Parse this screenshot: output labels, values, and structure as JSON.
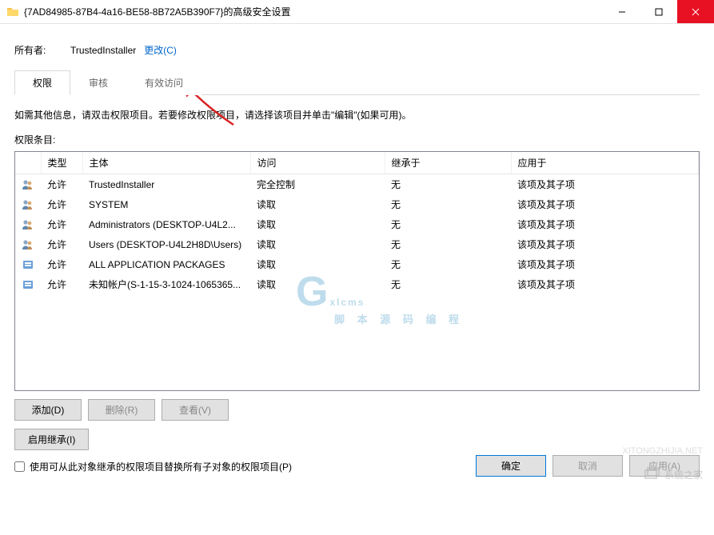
{
  "window": {
    "title": "{7AD84985-87B4-4a16-BE58-8B72A5B390F7}的高级安全设置"
  },
  "owner": {
    "label": "所有者:",
    "value": "TrustedInstaller",
    "change_link": "更改(C)"
  },
  "tabs": {
    "permissions": "权限",
    "audit": "审核",
    "effective": "有效访问"
  },
  "instructions": "如需其他信息，请双击权限项目。若要修改权限项目，请选择该项目并单击\"编辑\"(如果可用)。",
  "entries_label": "权限条目:",
  "columns": {
    "type": "类型",
    "principal": "主体",
    "access": "访问",
    "inherited_from": "继承于",
    "applies_to": "应用于"
  },
  "rows": [
    {
      "icon": "users",
      "type": "允许",
      "principal": "TrustedInstaller",
      "access": "完全控制",
      "inherited_from": "无",
      "applies_to": "该项及其子项"
    },
    {
      "icon": "users",
      "type": "允许",
      "principal": "SYSTEM",
      "access": "读取",
      "inherited_from": "无",
      "applies_to": "该项及其子项"
    },
    {
      "icon": "users",
      "type": "允许",
      "principal": "Administrators (DESKTOP-U4L2...",
      "access": "读取",
      "inherited_from": "无",
      "applies_to": "该项及其子项"
    },
    {
      "icon": "users",
      "type": "允许",
      "principal": "Users (DESKTOP-U4L2H8D\\Users)",
      "access": "读取",
      "inherited_from": "无",
      "applies_to": "该项及其子项"
    },
    {
      "icon": "package",
      "type": "允许",
      "principal": "ALL APPLICATION PACKAGES",
      "access": "读取",
      "inherited_from": "无",
      "applies_to": "该项及其子项"
    },
    {
      "icon": "package",
      "type": "允许",
      "principal": "未知帐户(S-1-15-3-1024-1065365...",
      "access": "读取",
      "inherited_from": "无",
      "applies_to": "该项及其子项"
    }
  ],
  "buttons": {
    "add": "添加(D)",
    "remove": "删除(R)",
    "view": "查看(V)",
    "enable_inherit": "启用继承(I)",
    "replace_checkbox": "使用可从此对象继承的权限项目替换所有子对象的权限项目(P)",
    "ok": "确定",
    "cancel": "取消",
    "apply": "应用(A)"
  },
  "watermarks": {
    "gxl_main": "Gxlcms",
    "gxl_sub": "脚 本  源 码  编 程",
    "xtzj": "系统之家",
    "url": "XITONGZHIJIA.NET"
  }
}
